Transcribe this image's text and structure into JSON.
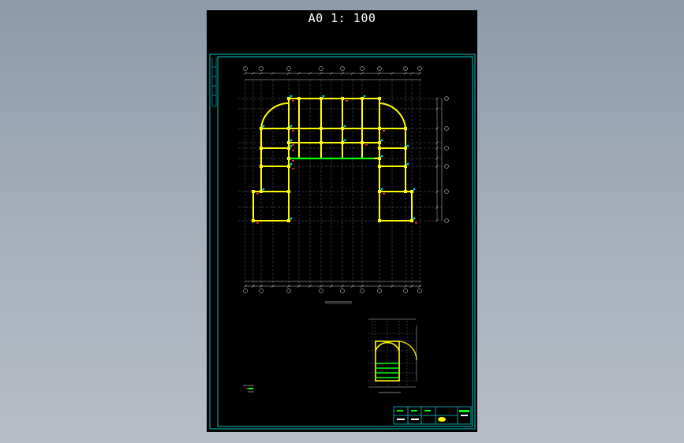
{
  "sheet": {
    "title": "A0 1: 100",
    "colors": {
      "background": "#000000",
      "frame": "#00c8c8",
      "grid": "#8a8a8a",
      "column": "#ffff00",
      "beam_highlight": "#00ff00",
      "marker": "#ff3030",
      "node": "#00c8ff"
    }
  }
}
